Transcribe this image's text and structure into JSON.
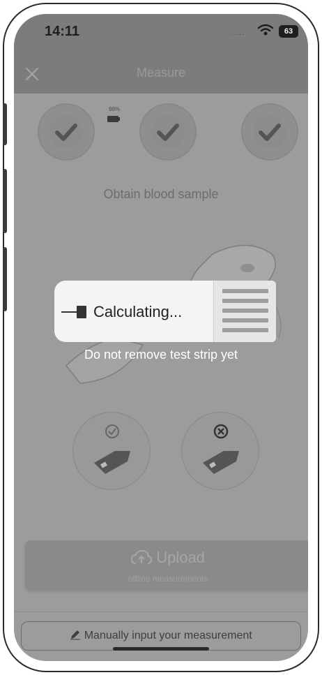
{
  "status_bar": {
    "time": "14:11",
    "signal": ".....",
    "battery": "63"
  },
  "nav": {
    "title": "Measure"
  },
  "steps": {
    "meter_battery": "98%"
  },
  "instruction": "Obtain blood sample",
  "upload": {
    "label": "Upload",
    "sublabel": "offline measurements"
  },
  "manual_input": {
    "label": "Manually input your measurement"
  },
  "modal": {
    "title": "Calculating...",
    "notice": "Do not remove test strip yet"
  },
  "colors": {
    "overlay": "#9c9c9c",
    "header": "#7c7c7c",
    "card": "#f4f4f4"
  }
}
